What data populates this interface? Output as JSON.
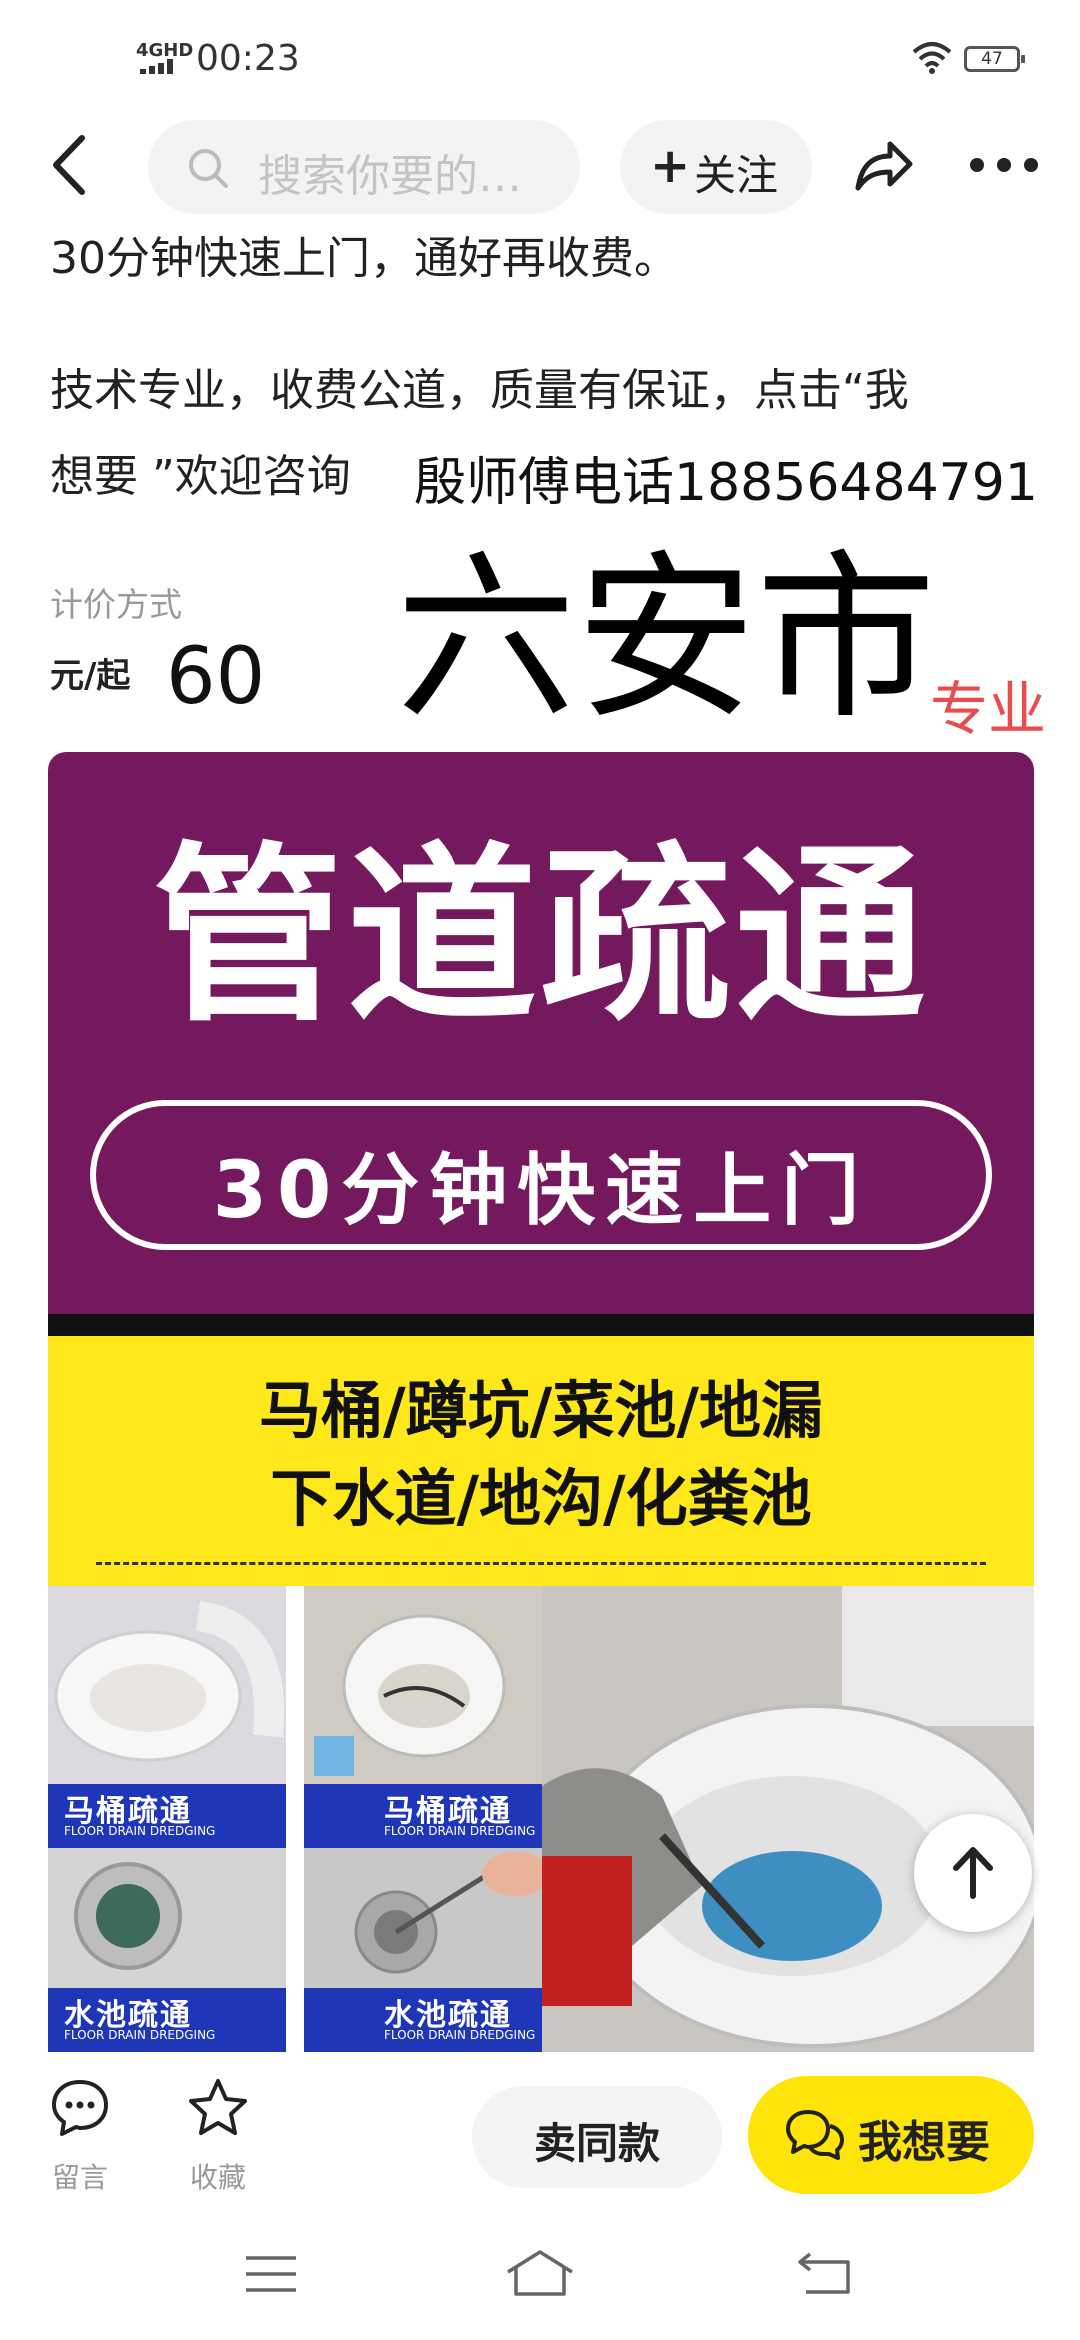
{
  "status_bar": {
    "network": "4GHD",
    "time": "00:23",
    "battery": "47"
  },
  "header": {
    "search_placeholder": "搜索你要的…",
    "follow_label": "关注"
  },
  "description": {
    "line1": "30分钟快速上门，通好再收费。",
    "line2": "技术专业，收费公道，质量有保证，点击“我",
    "line3": "想要 ”欢迎咨询",
    "phone_note": "殷师傅电话18856484791"
  },
  "pricing": {
    "label": "计价方式",
    "unit": "元/起",
    "price": "60"
  },
  "overlay": {
    "city": "六安市",
    "tag": "专业"
  },
  "poster": {
    "headline": "管道疏通",
    "subline": "30分钟快速上门",
    "services_row1": "马桶/蹲坑/菜池/地漏",
    "services_row2": "下水道/地沟/化粪池",
    "photos": [
      {
        "title": "马桶疏通",
        "sub": "FLOOR DRAIN DREDGING"
      },
      {
        "title": "马桶疏通",
        "sub": "FLOOR DRAIN DREDGING"
      },
      {
        "title": "水池疏通",
        "sub": "FLOOR DRAIN DREDGING"
      },
      {
        "title": "水池疏通",
        "sub": "FLOOR DRAIN DREDGING"
      }
    ]
  },
  "bottom_bar": {
    "comment_label": "留言",
    "favorite_label": "收藏",
    "sell_same_label": "卖同款",
    "want_label": "我想要"
  },
  "colors": {
    "poster_purple": "#74195e",
    "poster_yellow": "#ffe81a",
    "photo_label_blue": "#1f36b8",
    "want_button": "#ffe40a",
    "tag_red": "#e84c4c"
  },
  "icons": [
    "back-arrow-icon",
    "search-icon",
    "plus-icon",
    "share-icon",
    "more-icon",
    "arrow-up-icon",
    "comment-icon",
    "star-icon",
    "chat-icon",
    "menu-icon",
    "home-icon",
    "return-icon",
    "wifi-icon",
    "battery-icon"
  ]
}
